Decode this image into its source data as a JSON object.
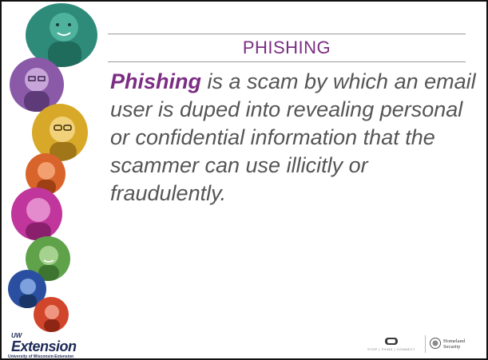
{
  "slide": {
    "title": "PHISHING",
    "body": {
      "term": "Phishing",
      "text": " is a scam by which an email user is duped into revealing personal or confidential information that the scammer can use illicitly or fraudulently."
    }
  },
  "footer": {
    "extension_logo": {
      "uw": "UW",
      "name": "Extension",
      "subtitle": "University of Wisconsin-Extension"
    },
    "stop_think_connect": {
      "text": "STOP | THINK | CONNECT"
    },
    "homeland_security": {
      "line1": "Homeland",
      "line2": "Security"
    }
  },
  "colors": {
    "accent": "#7b2d83",
    "body_text": "#555555",
    "rule": "#9a9a9a",
    "portrait_teal": "#2e8b7a",
    "portrait_purple": "#8a5aa8",
    "portrait_yellow": "#d8a928",
    "portrait_orange": "#d9642b",
    "portrait_magenta": "#c0369c",
    "portrait_green": "#5fa24a",
    "portrait_blue": "#2a4fa0",
    "portrait_red": "#d1452b",
    "extension_navy": "#1d2a57"
  },
  "icons": [
    "portrait-photo",
    "stop-think-connect-lock-icon",
    "dhs-seal-icon"
  ]
}
